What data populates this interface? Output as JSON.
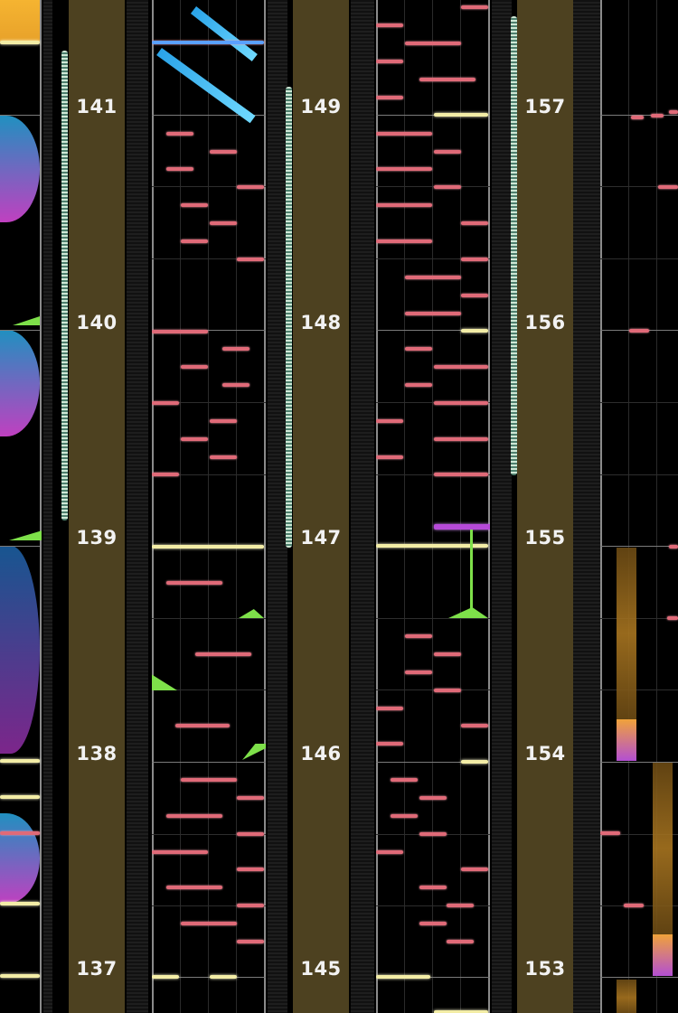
{
  "game": {
    "colors": {
      "background": "#000000",
      "measure_number_band": "#4d4120",
      "tap_note": "#e06a78",
      "hold_marker": "#f3eda6",
      "flick_note": "#7ee04a",
      "slide_note": "#4fc3f7",
      "accent_purple": "#b64ad8"
    },
    "columns": [
      {
        "id": "col-1",
        "measures": [
          {
            "number": "141"
          },
          {
            "number": "140"
          },
          {
            "number": "139"
          },
          {
            "number": "138"
          },
          {
            "number": "137"
          }
        ]
      },
      {
        "id": "col-2",
        "measures": [
          {
            "number": "149"
          },
          {
            "number": "148"
          },
          {
            "number": "147"
          },
          {
            "number": "146"
          },
          {
            "number": "145"
          }
        ]
      },
      {
        "id": "col-3",
        "measures": [
          {
            "number": "157"
          },
          {
            "number": "156"
          },
          {
            "number": "155"
          },
          {
            "number": "154"
          },
          {
            "number": "153"
          }
        ]
      }
    ]
  }
}
